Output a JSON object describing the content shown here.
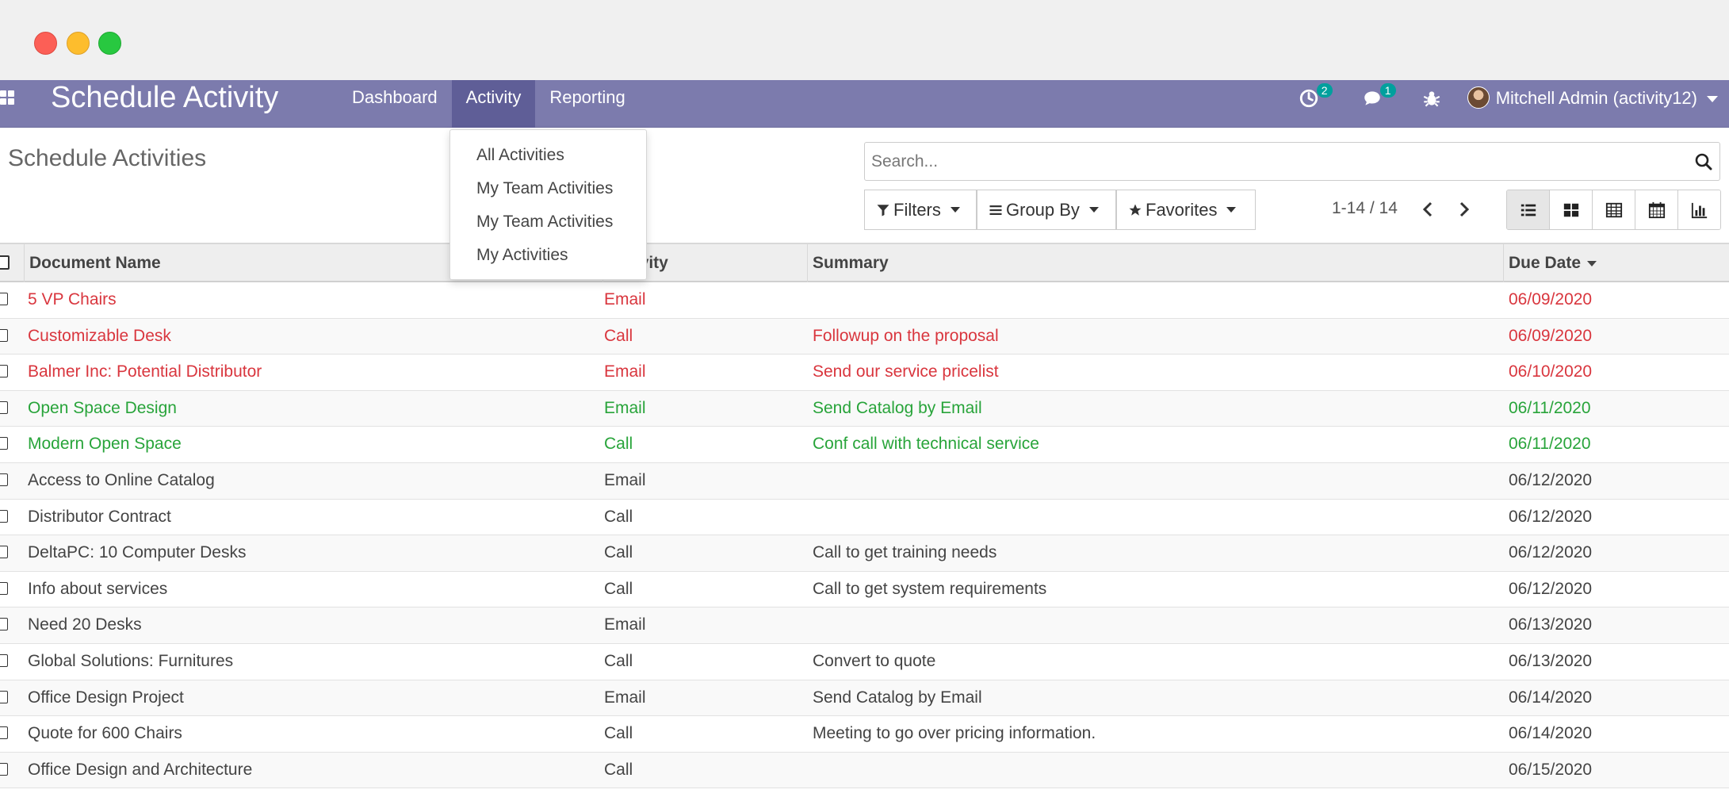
{
  "window": {
    "controls": [
      "close",
      "minimize",
      "maximize"
    ]
  },
  "navbar": {
    "app_title": "Schedule Activity",
    "menu": [
      {
        "label": "Dashboard"
      },
      {
        "label": "Activity"
      },
      {
        "label": "Reporting"
      }
    ],
    "active_menu": "Activity",
    "activity_badge": "2",
    "messages_badge": "1",
    "user_name": "Mitchell Admin (activity12)",
    "accent_color": "#7c7bad"
  },
  "activity_dropdown": {
    "items": [
      {
        "label": "All Activities"
      },
      {
        "label": "My Team Activities"
      },
      {
        "label": "My Team Activities"
      },
      {
        "label": "My Activities"
      }
    ]
  },
  "control_panel": {
    "breadcrumb": "Schedule Activities",
    "search_placeholder": "Search...",
    "filters_label": "Filters",
    "groupby_label": "Group By",
    "favorites_label": "Favorites",
    "pager_value": "1-14 / 14",
    "views": [
      "list-view",
      "kanban-view",
      "pivot-view",
      "calendar-view",
      "graph-view"
    ],
    "active_view": "list-view"
  },
  "table": {
    "headers": {
      "document": "Document Name",
      "activity": "Activity",
      "summary": "Summary",
      "due_date": "Due Date"
    },
    "status_colors": {
      "overdue": "#d9363e",
      "today": "#28a43a",
      "planned": "#444444"
    },
    "rows": [
      {
        "document": "5 VP Chairs",
        "activity": "Email",
        "summary": "",
        "due_date": "06/09/2020",
        "status": "overdue"
      },
      {
        "document": "Customizable Desk",
        "activity": "Call",
        "summary": "Followup on the proposal",
        "due_date": "06/09/2020",
        "status": "overdue"
      },
      {
        "document": "Balmer Inc: Potential Distributor",
        "activity": "Email",
        "summary": "Send our service pricelist",
        "due_date": "06/10/2020",
        "status": "overdue"
      },
      {
        "document": "Open Space Design",
        "activity": "Email",
        "summary": "Send Catalog by Email",
        "due_date": "06/11/2020",
        "status": "today"
      },
      {
        "document": "Modern Open Space",
        "activity": "Call",
        "summary": "Conf call with technical service",
        "due_date": "06/11/2020",
        "status": "today"
      },
      {
        "document": "Access to Online Catalog",
        "activity": "Email",
        "summary": "",
        "due_date": "06/12/2020",
        "status": "planned"
      },
      {
        "document": "Distributor Contract",
        "activity": "Call",
        "summary": "",
        "due_date": "06/12/2020",
        "status": "planned"
      },
      {
        "document": "DeltaPC: 10 Computer Desks",
        "activity": "Call",
        "summary": "Call to get training needs",
        "due_date": "06/12/2020",
        "status": "planned"
      },
      {
        "document": "Info about services",
        "activity": "Call",
        "summary": "Call to get system requirements",
        "due_date": "06/12/2020",
        "status": "planned"
      },
      {
        "document": "Need 20 Desks",
        "activity": "Email",
        "summary": "",
        "due_date": "06/13/2020",
        "status": "planned"
      },
      {
        "document": "Global Solutions: Furnitures",
        "activity": "Call",
        "summary": "Convert to quote",
        "due_date": "06/13/2020",
        "status": "planned"
      },
      {
        "document": "Office Design Project",
        "activity": "Email",
        "summary": "Send Catalog by Email",
        "due_date": "06/14/2020",
        "status": "planned"
      },
      {
        "document": "Quote for 600 Chairs",
        "activity": "Call",
        "summary": "Meeting to go over pricing information.",
        "due_date": "06/14/2020",
        "status": "planned"
      },
      {
        "document": "Office Design and Architecture",
        "activity": "Call",
        "summary": "",
        "due_date": "06/15/2020",
        "status": "planned"
      }
    ]
  }
}
